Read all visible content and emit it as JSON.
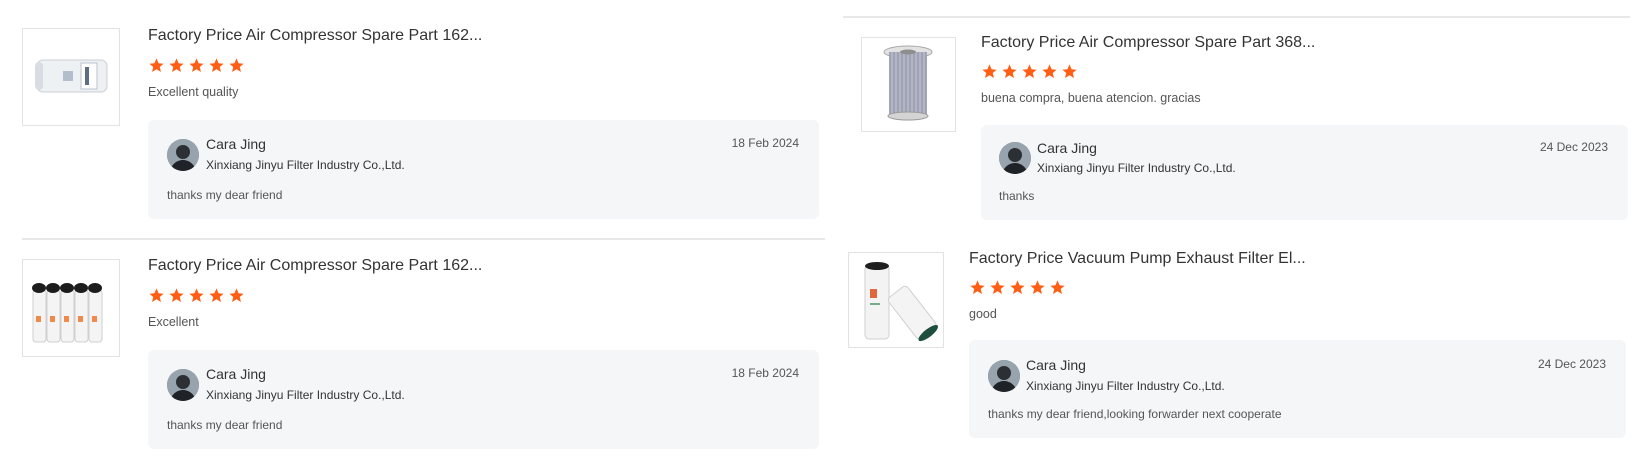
{
  "reviews": [
    {
      "product_title": "Factory Price Air Compressor Spare Part 162...",
      "rating": 5,
      "comment": "Excellent quality",
      "seller_name": "Cara Jing",
      "seller_company": "Xinxiang Jinyu Filter Industry Co.,Ltd.",
      "reply_date": "18 Feb 2024",
      "reply_text": "thanks my dear friend"
    },
    {
      "product_title": "Factory Price Air Compressor Spare Part 162...",
      "rating": 5,
      "comment": "Excellent",
      "seller_name": "Cara Jing",
      "seller_company": "Xinxiang Jinyu Filter Industry Co.,Ltd.",
      "reply_date": "18 Feb 2024",
      "reply_text": "thanks my dear friend"
    },
    {
      "product_title": "Factory Price Air Compressor Spare Part 368...",
      "rating": 5,
      "comment": "buena compra, buena atencion. gracias",
      "seller_name": "Cara Jing",
      "seller_company": "Xinxiang Jinyu Filter Industry Co.,Ltd.",
      "reply_date": "24 Dec 2023",
      "reply_text": "thanks"
    },
    {
      "product_title": "Factory Price Vacuum Pump Exhaust Filter El...",
      "rating": 5,
      "comment": "good",
      "seller_name": "Cara Jing",
      "seller_company": "Xinxiang Jinyu Filter Industry Co.,Ltd.",
      "reply_date": "24 Dec 2023",
      "reply_text": "thanks my dear friend,looking forwarder next cooperate"
    }
  ],
  "colors": {
    "star": "#ff5e14",
    "reply_bg": "#f5f6f8",
    "divider": "#e8e8e8"
  },
  "icons": {
    "rating": "star-icon",
    "avatar": "seller-avatar"
  }
}
